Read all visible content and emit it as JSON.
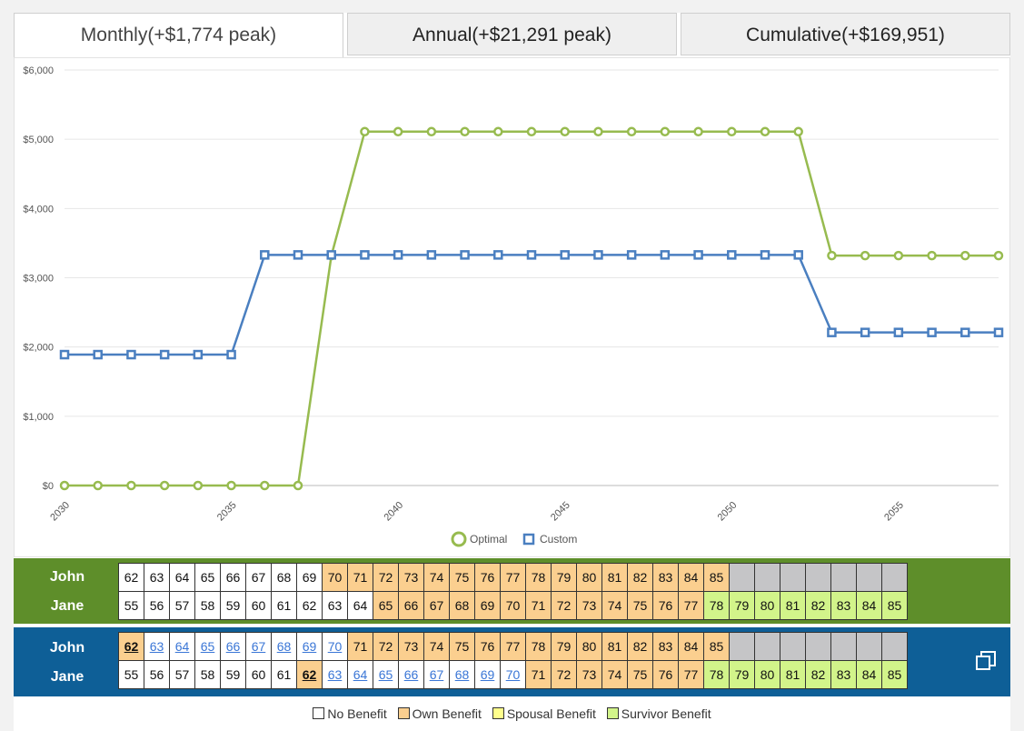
{
  "tabs": [
    {
      "label": "Monthly(+$1,774 peak)",
      "active": true
    },
    {
      "label": "Annual(+$21,291 peak)",
      "active": false
    },
    {
      "label": "Cumulative(+$169,951)",
      "active": false
    }
  ],
  "chart_data": {
    "type": "line",
    "x": [
      2030,
      2031,
      2032,
      2033,
      2034,
      2035,
      2036,
      2037,
      2038,
      2039,
      2040,
      2041,
      2042,
      2043,
      2044,
      2045,
      2046,
      2047,
      2048,
      2049,
      2050,
      2051,
      2052,
      2053,
      2054,
      2055,
      2056,
      2057,
      2058
    ],
    "series": [
      {
        "name": "Optimal",
        "color": "#97bb4f",
        "marker": "circle",
        "values": [
          0,
          0,
          0,
          0,
          0,
          0,
          0,
          0,
          3320,
          5110,
          5110,
          5110,
          5110,
          5110,
          5110,
          5110,
          5110,
          5110,
          5110,
          5110,
          5110,
          5110,
          5110,
          3320,
          3320,
          3320,
          3320,
          3320,
          3320
        ]
      },
      {
        "name": "Custom",
        "color": "#4a7fc0",
        "marker": "square",
        "values": [
          1890,
          1890,
          1890,
          1890,
          1890,
          1890,
          3330,
          3330,
          3330,
          3330,
          3330,
          3330,
          3330,
          3330,
          3330,
          3330,
          3330,
          3330,
          3330,
          3330,
          3330,
          3330,
          3330,
          2210,
          2210,
          2210,
          2210,
          2210,
          2210
        ]
      }
    ],
    "yticks": [
      "$0",
      "$1,000",
      "$2,000",
      "$3,000",
      "$4,000",
      "$5,000",
      "$6,000"
    ],
    "xticks": [
      "2030",
      "2035",
      "2040",
      "2045",
      "2050",
      "2055"
    ],
    "ylim": [
      0,
      6000
    ],
    "xlim": [
      2030,
      2058
    ],
    "grid": true,
    "legend": "bottom"
  },
  "bands": {
    "optimal": {
      "john": {
        "label": "John",
        "start": 62,
        "own_from": 70
      },
      "jane": {
        "label": "Jane",
        "start": 55,
        "own_from": 65,
        "survivor_from": 78
      }
    },
    "custom": {
      "john": {
        "label": "John",
        "start": 62,
        "claim": 62,
        "own_from": 71
      },
      "jane": {
        "label": "Jane",
        "start": 55,
        "claim": 62,
        "own_from": 71,
        "survivor_from": 78
      }
    },
    "copy_icon": "copy-icon"
  },
  "legend": {
    "items": [
      {
        "label": "No Benefit",
        "color": "#ffffff"
      },
      {
        "label": "Own Benefit",
        "color": "#fbcf8f"
      },
      {
        "label": "Spousal Benefit",
        "color": "#ffff8c"
      },
      {
        "label": "Survivor Benefit",
        "color": "#d2f48a"
      }
    ]
  }
}
